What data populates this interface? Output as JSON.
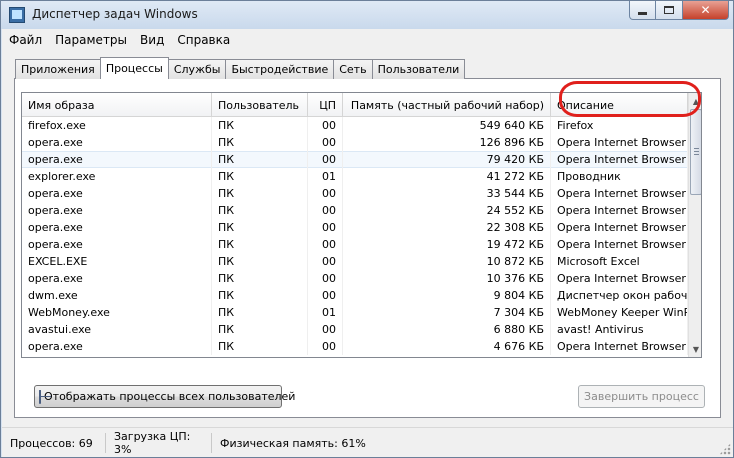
{
  "window": {
    "title": "Диспетчер задач Windows",
    "icon": "task-manager-icon",
    "controls": {
      "minimize": "minimize-icon",
      "maximize": "maximize-icon",
      "close": "✕"
    }
  },
  "menu": [
    "Файл",
    "Параметры",
    "Вид",
    "Справка"
  ],
  "tabs": [
    {
      "label": "Приложения",
      "active": false
    },
    {
      "label": "Процессы",
      "active": true
    },
    {
      "label": "Службы",
      "active": false
    },
    {
      "label": "Быстродействие",
      "active": false
    },
    {
      "label": "Сеть",
      "active": false
    },
    {
      "label": "Пользователи",
      "active": false
    }
  ],
  "table": {
    "columns": [
      "Имя образа",
      "Пользователь",
      "ЦП",
      "Память (частный рабочий набор)",
      "Описание"
    ],
    "rows": [
      [
        "firefox.exe",
        "ПК",
        "00",
        "549 640 КБ",
        "Firefox"
      ],
      [
        "opera.exe",
        "ПК",
        "00",
        "126 896 КБ",
        "Opera Internet Browser"
      ],
      [
        "opera.exe",
        "ПК",
        "00",
        "79 420 КБ",
        "Opera Internet Browser"
      ],
      [
        "explorer.exe",
        "ПК",
        "01",
        "41 272 КБ",
        "Проводник"
      ],
      [
        "opera.exe",
        "ПК",
        "00",
        "33 544 КБ",
        "Opera Internet Browser"
      ],
      [
        "opera.exe",
        "ПК",
        "00",
        "24 552 КБ",
        "Opera Internet Browser"
      ],
      [
        "opera.exe",
        "ПК",
        "00",
        "22 308 КБ",
        "Opera Internet Browser"
      ],
      [
        "opera.exe",
        "ПК",
        "00",
        "19 472 КБ",
        "Opera Internet Browser"
      ],
      [
        "EXCEL.EXE",
        "ПК",
        "00",
        "10 872 КБ",
        "Microsoft Excel"
      ],
      [
        "opera.exe",
        "ПК",
        "00",
        "10 376 КБ",
        "Opera Internet Browser"
      ],
      [
        "dwm.exe",
        "ПК",
        "00",
        "9 804 КБ",
        "Диспетчер окон рабочего"
      ],
      [
        "WebMoney.exe",
        "ПК",
        "01",
        "7 304 КБ",
        "WebMoney Keeper WinPro"
      ],
      [
        "avastui.exe",
        "ПК",
        "00",
        "6 880 КБ",
        "avast! Antivirus"
      ],
      [
        "opera.exe",
        "ПК",
        "00",
        "4 676 КБ",
        "Opera Internet Browser"
      ]
    ],
    "selected_row": 2,
    "highlight_color": "#e0201c"
  },
  "buttons": {
    "show_all": "Отображать процессы всех пользователей",
    "end_process": "Завершить процесс"
  },
  "status": {
    "processes": "Процессов: 69",
    "cpu": "Загрузка ЦП: 3%",
    "memory": "Физическая память: 61%"
  }
}
